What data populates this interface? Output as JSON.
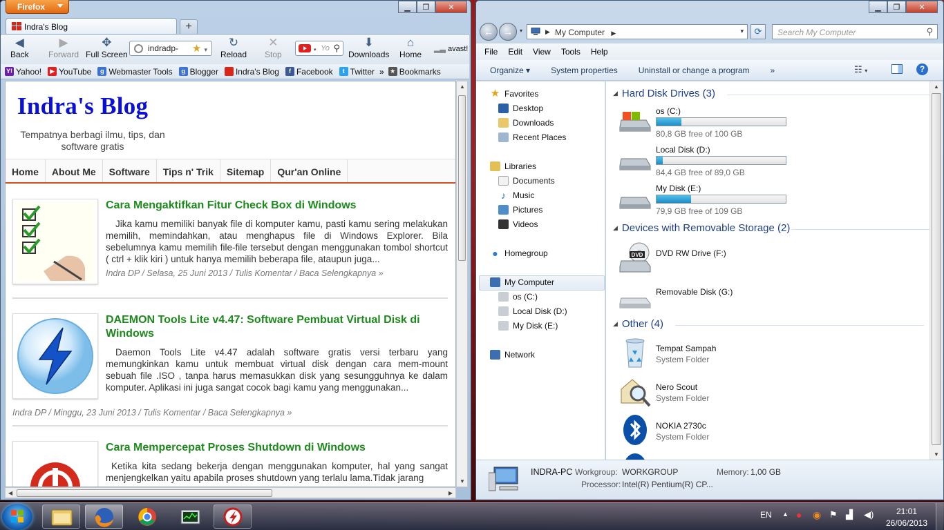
{
  "firefox": {
    "app_button": "Firefox",
    "tab_title": "Indra's Blog",
    "new_tab": "+",
    "nav": {
      "back": "Back",
      "forward": "Forward",
      "fullscreen": "Full Screen",
      "url": "indradp-",
      "reload": "Reload",
      "stop": "Stop",
      "search_placeholder": "Yo",
      "downloads": "Downloads",
      "home": "Home",
      "avast": "avast!"
    },
    "bookmarks": [
      {
        "label": "Yahoo!",
        "color": "#6e1fa8",
        "glyph": "Y!"
      },
      {
        "label": "YouTube",
        "color": "#e02020",
        "glyph": "▶"
      },
      {
        "label": "Webmaster Tools",
        "color": "#3b74d6",
        "glyph": "g"
      },
      {
        "label": "Blogger",
        "color": "#3b74d6",
        "glyph": "g"
      },
      {
        "label": "Indra's Blog",
        "color": "#d8261b",
        "glyph": ""
      },
      {
        "label": "Facebook",
        "color": "#3b5998",
        "glyph": "f"
      },
      {
        "label": "Twitter",
        "color": "#2aa3ef",
        "glyph": "t"
      }
    ],
    "bookmarks_more": "»",
    "bookmarks_menu": "Bookmarks"
  },
  "blog": {
    "title": "Indra's Blog",
    "subtitle": "Tempatnya berbagi ilmu, tips, dan software gratis",
    "menu": [
      "Home",
      "About Me",
      "Software",
      "Tips n' Trik",
      "Sitemap",
      "Qur'an Online"
    ],
    "posts": [
      {
        "title": "Cara Mengaktifkan Fitur Check Box di Windows",
        "excerpt": "Jika kamu memiliki banyak file di komputer kamu, pasti kamu sering melakukan memilih, memindahkan, atau menghapus file di Windows Explorer. Bila sebelumnya kamu memilih file-file tersebut dengan menggunakan tombol shortcut ( ctrl + klik kiri ) untuk hanya memilih beberapa file, ataupun juga...",
        "meta": "Indra DP / Selasa, 25 Juni 2013 / Tulis Komentar / Baca Selengkapnya »"
      },
      {
        "title": "DAEMON Tools Lite v4.47: Software Pembuat Virtual Disk di Windows",
        "excerpt": "Daemon Tools Lite v4.47 adalah software gratis versi terbaru yang memungkinkan kamu untuk membuat virtual disk dengan cara mem-mount sebuah file .ISO , tanpa harus memasukkan disk yang sesungguhnya ke dalam komputer. Aplikasi ini juga sangat cocok bagi kamu yang menggunakan...",
        "meta": "Indra DP / Minggu, 23 Juni 2013 / Tulis Komentar / Baca Selengkapnya »"
      },
      {
        "title": "Cara Mempercepat Proses Shutdown di Windows",
        "excerpt": "Ketika kita sedang bekerja dengan menggunakan komputer, hal yang sangat menjengkelkan yaitu apabila proses shutdown yang terlalu lama.Tidak jarang",
        "meta": ""
      }
    ]
  },
  "explorer": {
    "address": "My Computer",
    "search_placeholder": "Search My Computer",
    "menu": [
      "File",
      "Edit",
      "View",
      "Tools",
      "Help"
    ],
    "commands": [
      "Organize ▾",
      "System properties",
      "Uninstall or change a program",
      "»"
    ],
    "nav_pane": {
      "favorites": "Favorites",
      "favorite_items": [
        "Desktop",
        "Downloads",
        "Recent Places"
      ],
      "libraries": "Libraries",
      "library_items": [
        "Documents",
        "Music",
        "Pictures",
        "Videos"
      ],
      "homegroup": "Homegroup",
      "computer": "My Computer",
      "computer_items": [
        "os (C:)",
        "Local Disk (D:)",
        "My Disk (E:)"
      ],
      "network": "Network"
    },
    "groups": {
      "hdd": "Hard Disk Drives (3)",
      "removable": "Devices with Removable Storage (2)",
      "other": "Other (4)"
    },
    "drives": [
      {
        "name": "os (C:)",
        "free": "80,8 GB free of 100 GB",
        "used_fraction": 0.19
      },
      {
        "name": "Local Disk (D:)",
        "free": "84,4 GB free of 89,0 GB",
        "used_fraction": 0.05
      },
      {
        "name": "My Disk (E:)",
        "free": "79,9 GB free of 109 GB",
        "used_fraction": 0.27
      }
    ],
    "removable": [
      {
        "name": "DVD RW Drive (F:)",
        "icon_label": "DVD"
      },
      {
        "name": "Removable Disk (G:)"
      }
    ],
    "other": [
      {
        "name": "Tempat Sampah",
        "sub": "System Folder"
      },
      {
        "name": "Nero Scout",
        "sub": "System Folder"
      },
      {
        "name": "NOKIA 2730c",
        "sub": "System Folder"
      }
    ],
    "details": {
      "pc_name": "INDRA-PC",
      "workgroup_label": "Workgroup:",
      "workgroup": "WORKGROUP",
      "memory_label": "Memory:",
      "memory": "1,00 GB",
      "processor_label": "Processor:",
      "processor": "Intel(R) Pentium(R) CP..."
    }
  },
  "taskbar": {
    "language": "EN",
    "time": "21:01",
    "date": "26/06/2013"
  },
  "colors": {
    "blog_title": "#0a10d6",
    "post_title": "#1e8a1e",
    "nav_accent": "#d05020",
    "drive_bar": "#26a0da"
  }
}
